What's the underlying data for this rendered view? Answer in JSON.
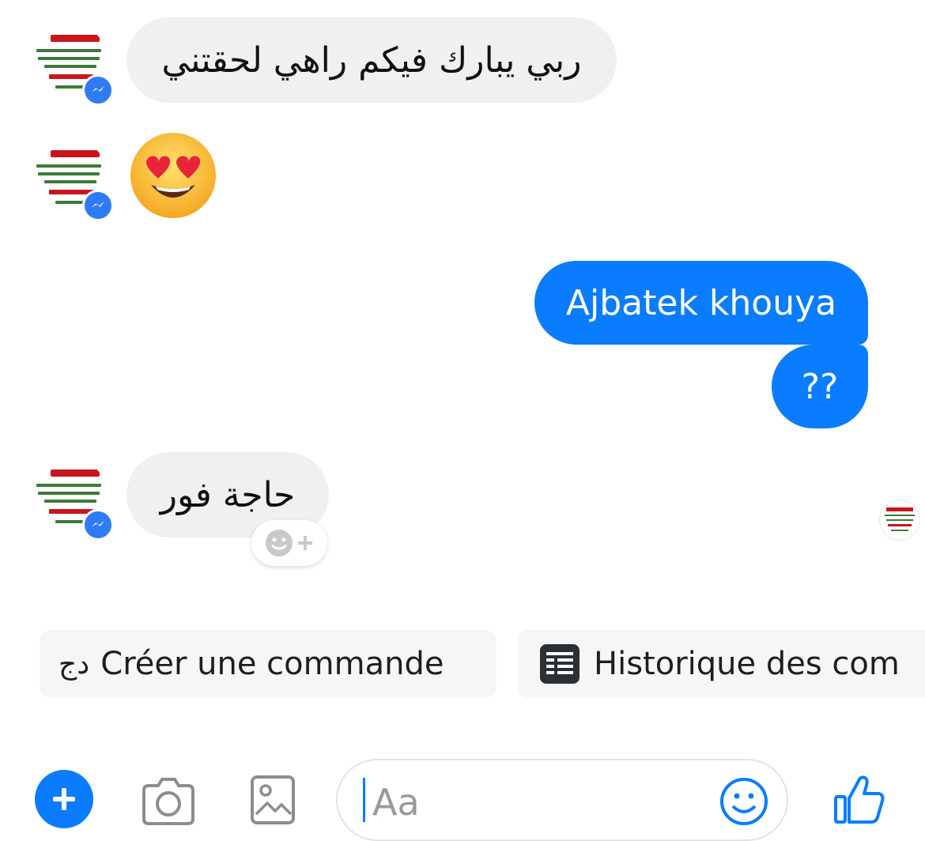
{
  "conversation": {
    "messages": [
      {
        "sender": "contact",
        "text": "ربي يبارك فيكم راهي لحقتني"
      },
      {
        "sender": "contact",
        "emoji": "heart-eyes-face"
      },
      {
        "sender": "me",
        "text": "Ajbatek khouya"
      },
      {
        "sender": "me",
        "text": "??"
      },
      {
        "sender": "contact",
        "text": "حاجة فور"
      }
    ]
  },
  "quick_replies": [
    {
      "label": "Créer une commande",
      "prefix": "دج",
      "icon": "currency-dz"
    },
    {
      "label": "Historique des com",
      "icon": "receipt-list-icon"
    }
  ],
  "composer": {
    "placeholder": "Aa",
    "actions": [
      "add-icon",
      "camera-icon",
      "gallery-icon",
      "emoji-icon",
      "like-icon"
    ]
  },
  "colors": {
    "outgoing_bubble": "#0a7cff",
    "incoming_bubble": "#f1f0f0",
    "accent": "#2f7bf5",
    "quick_reply_bg": "#f6f6f6"
  }
}
